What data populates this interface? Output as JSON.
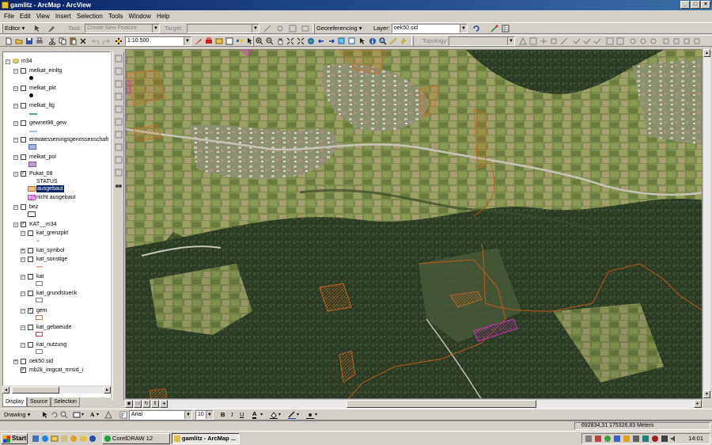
{
  "window": {
    "title": "gamlitz - ArcMap - ArcView"
  },
  "menu": [
    "File",
    "Edit",
    "View",
    "Insert",
    "Selection",
    "Tools",
    "Window",
    "Help"
  ],
  "editor_toolbar": {
    "editor_label": "Editor",
    "task_label": "Task:",
    "task_value": "Create New Feature",
    "target_label": "Target:",
    "georef_label": "Georeferencing",
    "layer_label": "Layer:",
    "layer_value": "oek50.sid"
  },
  "standard_toolbar": {
    "scale_value": "1:10.500",
    "topology_label": "Topology:"
  },
  "toc": {
    "root": "m34",
    "layers": [
      {
        "name": "melkat_einltg",
        "checked": false
      },
      {
        "name": "melkat_pkt",
        "checked": false
      },
      {
        "name": "melkat_ltg",
        "checked": false
      },
      {
        "name": "gewnet96_gew",
        "checked": false
      },
      {
        "name": "entwaesserungsgenossenschaft",
        "checked": false
      },
      {
        "name": "melkat_pol",
        "checked": false
      },
      {
        "name": "Pukat_08",
        "checked": true
      }
    ],
    "status_field": "STATUS",
    "status_values": [
      "ausgebaut",
      "nicht ausgebaut"
    ],
    "bez": "bez",
    "group": "KAT__m34",
    "sublayers": [
      {
        "name": "kat_grenzpkt",
        "checked": false
      },
      {
        "name": "kat_symbol",
        "checked": false
      },
      {
        "name": "kat_sonstige",
        "checked": false
      },
      {
        "name": "kat",
        "checked": false
      },
      {
        "name": "kat_grundstueck",
        "checked": false
      },
      {
        "name": "gem",
        "checked": true
      },
      {
        "name": "kat_gebaeude",
        "checked": false
      },
      {
        "name": "kat_nutzung",
        "checked": false
      }
    ],
    "bottom_layers": [
      {
        "name": "oek50.sid",
        "checked": false
      },
      {
        "name": "mb2k_imgcat_mrsid_i",
        "checked": true
      }
    ]
  },
  "toc_tabs": [
    "Display",
    "Source",
    "Selection"
  ],
  "drawing_toolbar": {
    "drawing_label": "Drawing",
    "font": "Arial",
    "size": "10"
  },
  "status": {
    "coords": "692834,31  175326,83 Meters"
  },
  "taskbar": {
    "start": "Start",
    "tasks": [
      "CorelDRAW 12",
      "gamlitz - ArcMap ..."
    ],
    "clock": "14:01"
  },
  "colors": {
    "titlebar": "#0a246a",
    "selection": "#0a246a",
    "parcel_orange": "#d06a1e",
    "parcel_magenta": "#d030c0",
    "boundary": "#c05a18"
  }
}
